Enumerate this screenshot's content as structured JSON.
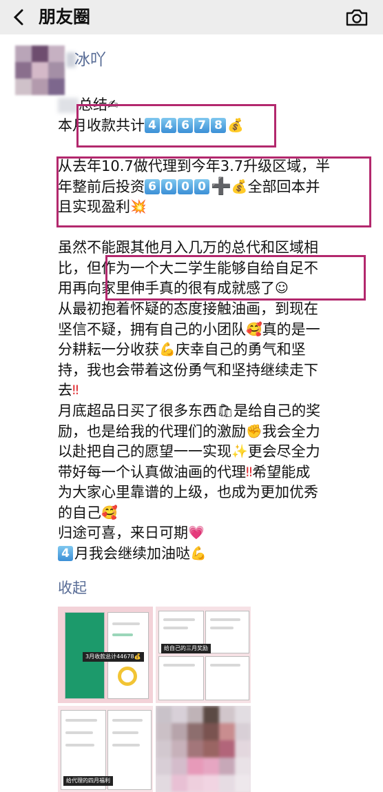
{
  "topbar": {
    "title": "朋友圈",
    "back_icon": "chevron-left-icon",
    "camera_icon": "camera-icon"
  },
  "post": {
    "author": "冰吖",
    "lines": [
      [
        "总结"
      ],
      [
        "本月收款共计"
      ],
      [],
      [
        "从去年10.7做代理到今年3.7升级区域，半"
      ],
      [
        "年整前后投资"
      ],
      [
        "且实现盈利"
      ],
      [],
      [
        "虽然不能跟其他月入几万的总代和区域相"
      ],
      [
        "比，但作为一个大二学生能够自给自足不"
      ],
      [
        "用再向家里伸手真的很有成就感了"
      ],
      [
        "从最初抱着怀疑的态度接触油画，到现在"
      ],
      [
        "坚信不疑，拥有自己的小团队",
        "真的是一"
      ],
      [
        "分耕耘一分收获",
        "庆幸自己的勇气和坚"
      ],
      [
        "持，我也会带着这份勇气和坚持继续走下"
      ],
      [
        "去"
      ],
      [
        "月底超品日买了很多东西",
        "是给自己的奖"
      ],
      [
        "励，也是给我的代理们的激励",
        "我会全力"
      ],
      [
        "以赴把自己的愿望一一实现",
        "更会尽全力"
      ],
      [
        "带好每一个认真做油画的代理",
        "希望能成"
      ],
      [
        "为大家心里靠谱的上级，也成为更加优秀"
      ],
      [
        "的自己"
      ],
      [
        "归途可喜，来日可期"
      ],
      [
        "月我会继续加油哒"
      ]
    ],
    "amount_digits": [
      "4",
      "4",
      "6",
      "7",
      "8"
    ],
    "invest_digits": [
      "6",
      "0",
      "0",
      "0"
    ],
    "april_digit": "4",
    "plus_sign": "➕",
    "tail_after_plus": "全部回本并",
    "emojis": {
      "writing": "✍",
      "money_bag": "💰",
      "boom": "💥",
      "relieved": "☺",
      "love": "🥰",
      "muscle": "💪",
      "double_exclamation": "‼",
      "shopping_bag": "🛍",
      "fist": "✊",
      "sparkles": "✨",
      "heart": "💗"
    },
    "collapse_label": "收起"
  },
  "thumbnails": {
    "caption_1": "3月收款总计44678💰",
    "caption_2": "给自己的三月奖励",
    "caption_3": "给代理的四月福利"
  },
  "colors": {
    "link": "#576b95",
    "highlight": "#b3286d",
    "topbar": "#ededed"
  }
}
